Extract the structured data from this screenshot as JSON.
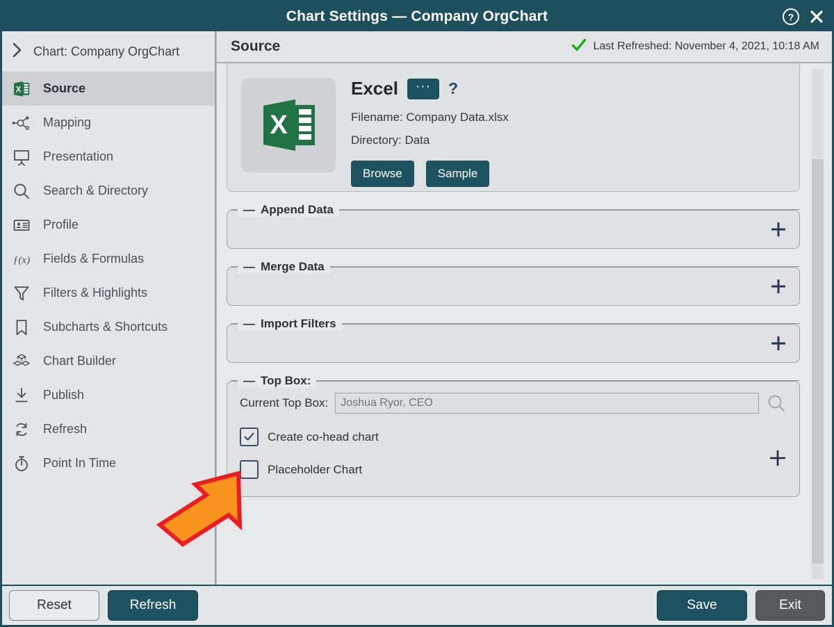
{
  "window": {
    "title": "Chart Settings — Company OrgChart",
    "help_icon": "help-circle-icon",
    "close_icon": "close-icon",
    "accent_color": "#1d4f5c"
  },
  "sidebar": {
    "chart_header": {
      "chevron": "〉",
      "label": "Chart: Company OrgChart"
    },
    "items": [
      {
        "label": "Source",
        "icon": "excel-icon",
        "active": true
      },
      {
        "label": "Mapping",
        "icon": "mapping-nodes-icon",
        "active": false
      },
      {
        "label": "Presentation",
        "icon": "presentation-screen-icon",
        "active": false
      },
      {
        "label": "Search & Directory",
        "icon": "search-icon",
        "active": false
      },
      {
        "label": "Profile",
        "icon": "id-card-icon",
        "active": false
      },
      {
        "label": "Fields & Formulas",
        "icon": "function-fx-icon",
        "active": false
      },
      {
        "label": "Filters & Highlights",
        "icon": "funnel-filter-icon",
        "active": false
      },
      {
        "label": "Subcharts & Shortcuts",
        "icon": "bookmark-icon",
        "active": false
      },
      {
        "label": "Chart Builder",
        "icon": "blocks-cube-icon",
        "active": false
      },
      {
        "label": "Publish",
        "icon": "publish-download-icon",
        "active": false
      },
      {
        "label": "Refresh",
        "icon": "refresh-cycle-icon",
        "active": false
      },
      {
        "label": "Point In Time",
        "icon": "stopwatch-icon",
        "active": false
      }
    ]
  },
  "main": {
    "section_title": "Source",
    "status": {
      "check_icon": "green-check-icon",
      "text": "Last Refreshed: November 4, 2021, 10:18 AM",
      "check_color": "#16ad16"
    },
    "source_card": {
      "thumbnail_icon": "excel-file-icon",
      "title": "Excel",
      "more_button_label": "···",
      "help_label": "?",
      "filename_line": "Filename: Company Data.xlsx",
      "directory_line": "Directory: Data",
      "browse_label": "Browse",
      "sample_label": "Sample"
    },
    "sections": [
      {
        "legend": "Append Data",
        "add_icon": "plus-icon"
      },
      {
        "legend": "Merge Data",
        "add_icon": "plus-icon"
      },
      {
        "legend": "Import Filters",
        "add_icon": "plus-icon"
      }
    ],
    "top_box": {
      "legend": "Top Box:",
      "field_label": "Current Top Box:",
      "field_value": "Joshua Ryor, CEO",
      "field_placeholder": "Joshua Ryor, CEO",
      "search_icon": "search-icon",
      "add_icon": "plus-icon",
      "checkboxes": [
        {
          "label": "Create co-head chart",
          "checked": true
        },
        {
          "label": "Placeholder Chart",
          "checked": false
        }
      ]
    }
  },
  "footer": {
    "reset_label": "Reset",
    "refresh_label": "Refresh",
    "save_label": "Save",
    "exit_label": "Exit"
  },
  "annotation": {
    "arrow": "orange-arrow-pointer",
    "fill_color": "#F7941E",
    "stroke_color": "#ED1C24"
  }
}
